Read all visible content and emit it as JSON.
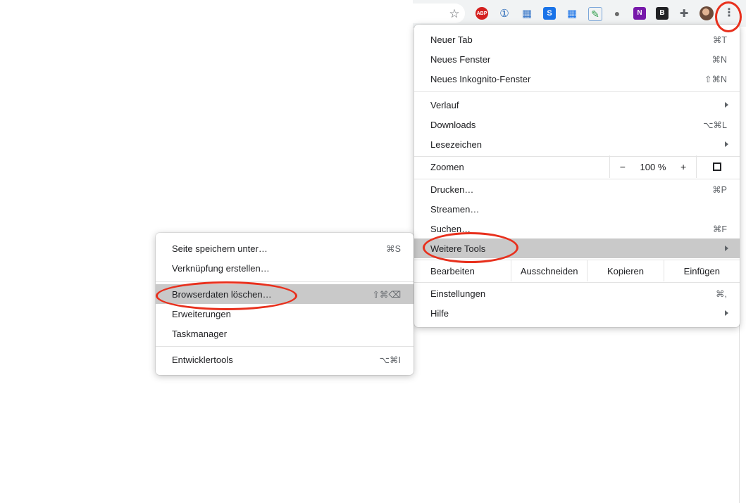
{
  "toolbar": {
    "icons": [
      {
        "name": "bookmark-star-icon",
        "glyph": "☆"
      },
      {
        "name": "adblock-plus-icon",
        "glyph": "ABP"
      },
      {
        "name": "onepassword-icon",
        "glyph": "①"
      },
      {
        "name": "puzzle-ext-icon",
        "glyph": "▦"
      },
      {
        "name": "s-extension-icon",
        "glyph": "S"
      },
      {
        "name": "grid-extension-icon",
        "glyph": "▦"
      },
      {
        "name": "checklist-icon",
        "glyph": "✎"
      },
      {
        "name": "circle-extension-icon",
        "glyph": "●"
      },
      {
        "name": "onenote-icon",
        "glyph": "N"
      },
      {
        "name": "b-extension-icon",
        "glyph": "B"
      },
      {
        "name": "extensions-puzzle-icon",
        "glyph": "✚"
      },
      {
        "name": "profile-avatar-icon",
        "glyph": ""
      },
      {
        "name": "kebab-menu-icon",
        "glyph": "⋮"
      }
    ]
  },
  "main_menu": {
    "group1": [
      {
        "label": "Neuer Tab",
        "shortcut": "⌘T"
      },
      {
        "label": "Neues Fenster",
        "shortcut": "⌘N"
      },
      {
        "label": "Neues Inkognito-Fenster",
        "shortcut": "⇧⌘N"
      }
    ],
    "group2": [
      {
        "label": "Verlauf",
        "shortcut": ""
      },
      {
        "label": "Downloads",
        "shortcut": "⌥⌘L"
      },
      {
        "label": "Lesezeichen",
        "shortcut": ""
      }
    ],
    "zoom": {
      "label": "Zoomen",
      "minus": "−",
      "value": "100 %",
      "plus": "+"
    },
    "group3": [
      {
        "label": "Drucken…",
        "shortcut": "⌘P"
      },
      {
        "label": "Streamen…",
        "shortcut": ""
      },
      {
        "label": "Suchen…",
        "shortcut": "⌘F"
      },
      {
        "label": "Weitere Tools",
        "shortcut": ""
      }
    ],
    "edit": {
      "label": "Bearbeiten",
      "cut": "Ausschneiden",
      "copy": "Kopieren",
      "paste": "Einfügen"
    },
    "group4": [
      {
        "label": "Einstellungen",
        "shortcut": "⌘,"
      },
      {
        "label": "Hilfe",
        "shortcut": ""
      }
    ]
  },
  "sub_menu": {
    "group1": [
      {
        "label": "Seite speichern unter…",
        "shortcut": "⌘S"
      },
      {
        "label": "Verknüpfung erstellen…",
        "shortcut": ""
      }
    ],
    "group2": [
      {
        "label": "Browserdaten löschen…",
        "shortcut": "⇧⌘⌫"
      },
      {
        "label": "Erweiterungen",
        "shortcut": ""
      },
      {
        "label": "Taskmanager",
        "shortcut": ""
      }
    ],
    "group3": [
      {
        "label": "Entwicklertools",
        "shortcut": "⌥⌘I"
      }
    ]
  },
  "colors": {
    "highlight_ring": "#e8301d",
    "menu_highlight": "#c9c9c9",
    "adblock": "#d4201f",
    "s_ext": "#1a73e8",
    "onenote": "#7719aa"
  }
}
